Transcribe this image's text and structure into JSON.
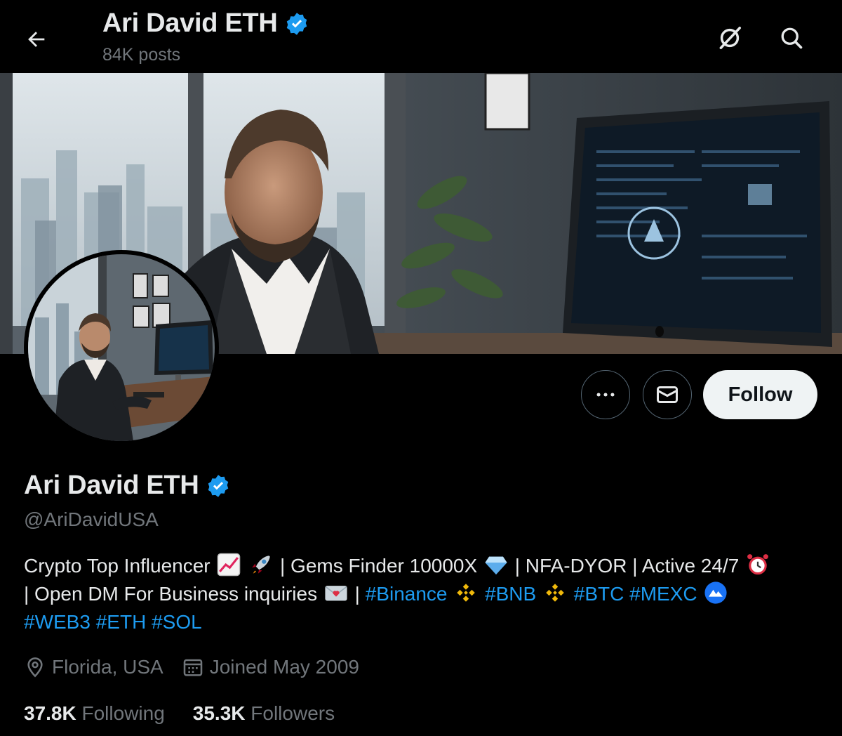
{
  "header": {
    "name": "Ari David ETH",
    "posts": "84K posts"
  },
  "profile": {
    "name": "Ari David ETH",
    "handle": "@AriDavidUSA",
    "follow_label": "Follow",
    "bio": {
      "text1": "Crypto Top Influencer",
      "text2": "| Gems Finder 10000X",
      "text3": "| NFA-DYOR | Active 24/7",
      "text4": "| Open DM For Business inquiries",
      "text5": "|",
      "tag_binance": "#Binance",
      "tag_bnb": "#BNB",
      "tag_btc": "#BTC",
      "tag_mexc": "#MEXC",
      "tag_web3": "#WEB3",
      "tag_eth": "#ETH",
      "tag_sol": "#SOL"
    },
    "location": "Florida, USA",
    "joined": "Joined May 2009",
    "following_count": "37.8K",
    "following_label": "Following",
    "followers_count": "35.3K",
    "followers_label": "Followers"
  },
  "icons": {
    "back": "arrow-left-icon",
    "grok": "grok-icon",
    "search": "search-icon",
    "more": "more-icon",
    "message": "envelope-icon",
    "verified": "verified-badge-icon",
    "location": "location-pin-icon",
    "calendar": "calendar-icon"
  },
  "colors": {
    "accent": "#1d9bf0",
    "background": "#000000",
    "secondary_text": "#71767b",
    "binance": "#f0b90b"
  }
}
